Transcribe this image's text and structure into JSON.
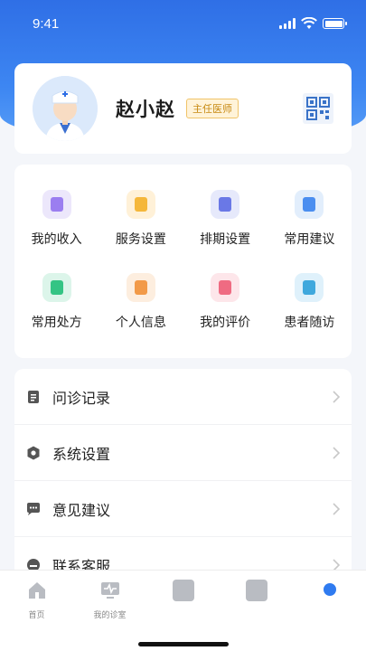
{
  "status_bar": {
    "time": "9:41",
    "icons": [
      "signal-icon",
      "wifi-icon",
      "battery-icon"
    ]
  },
  "profile": {
    "name": "赵小赵",
    "title_badge": "主任医师",
    "avatar_icon": "doctor-avatar-icon",
    "qr_icon": "qr-code-icon"
  },
  "grid": [
    {
      "label": "我的收入",
      "icon": "income-icon",
      "bg": "#ece7fb",
      "color": "#9b7ef0"
    },
    {
      "label": "服务设置",
      "icon": "service-icon",
      "bg": "#fff1d8",
      "color": "#f5b73a"
    },
    {
      "label": "排期设置",
      "icon": "calendar-icon",
      "bg": "#e6e9fb",
      "color": "#6a78e6"
    },
    {
      "label": "常用建议",
      "icon": "chat-icon",
      "bg": "#e2eefc",
      "color": "#4a8ef0"
    },
    {
      "label": "常用处方",
      "icon": "prescription-icon",
      "bg": "#dcf5ea",
      "color": "#34c484"
    },
    {
      "label": "个人信息",
      "icon": "profile-card-icon",
      "bg": "#fdeedf",
      "color": "#f29a48"
    },
    {
      "label": "我的评价",
      "icon": "review-icon",
      "bg": "#fde6ea",
      "color": "#ef6b82"
    },
    {
      "label": "患者随访",
      "icon": "followup-icon",
      "bg": "#dff1fb",
      "color": "#3fa8dd"
    }
  ],
  "menu": [
    {
      "label": "问诊记录",
      "icon": "record-icon"
    },
    {
      "label": "系统设置",
      "icon": "settings-icon"
    },
    {
      "label": "意见建议",
      "icon": "feedback-icon"
    },
    {
      "label": "联系客服",
      "icon": "customer-service-icon"
    }
  ],
  "tabbar": [
    {
      "label": "首页",
      "icon": "home-icon"
    },
    {
      "label": "我的诊室",
      "icon": "clinic-icon"
    },
    {
      "label": "",
      "icon": "tab-icon-3"
    },
    {
      "label": "",
      "icon": "tab-icon-4"
    },
    {
      "label": "",
      "icon": "tab-icon-5"
    }
  ],
  "colors": {
    "brand_blue": "#2f6fe6",
    "badge_text": "#c78a12",
    "badge_bg": "#fff3d9"
  }
}
